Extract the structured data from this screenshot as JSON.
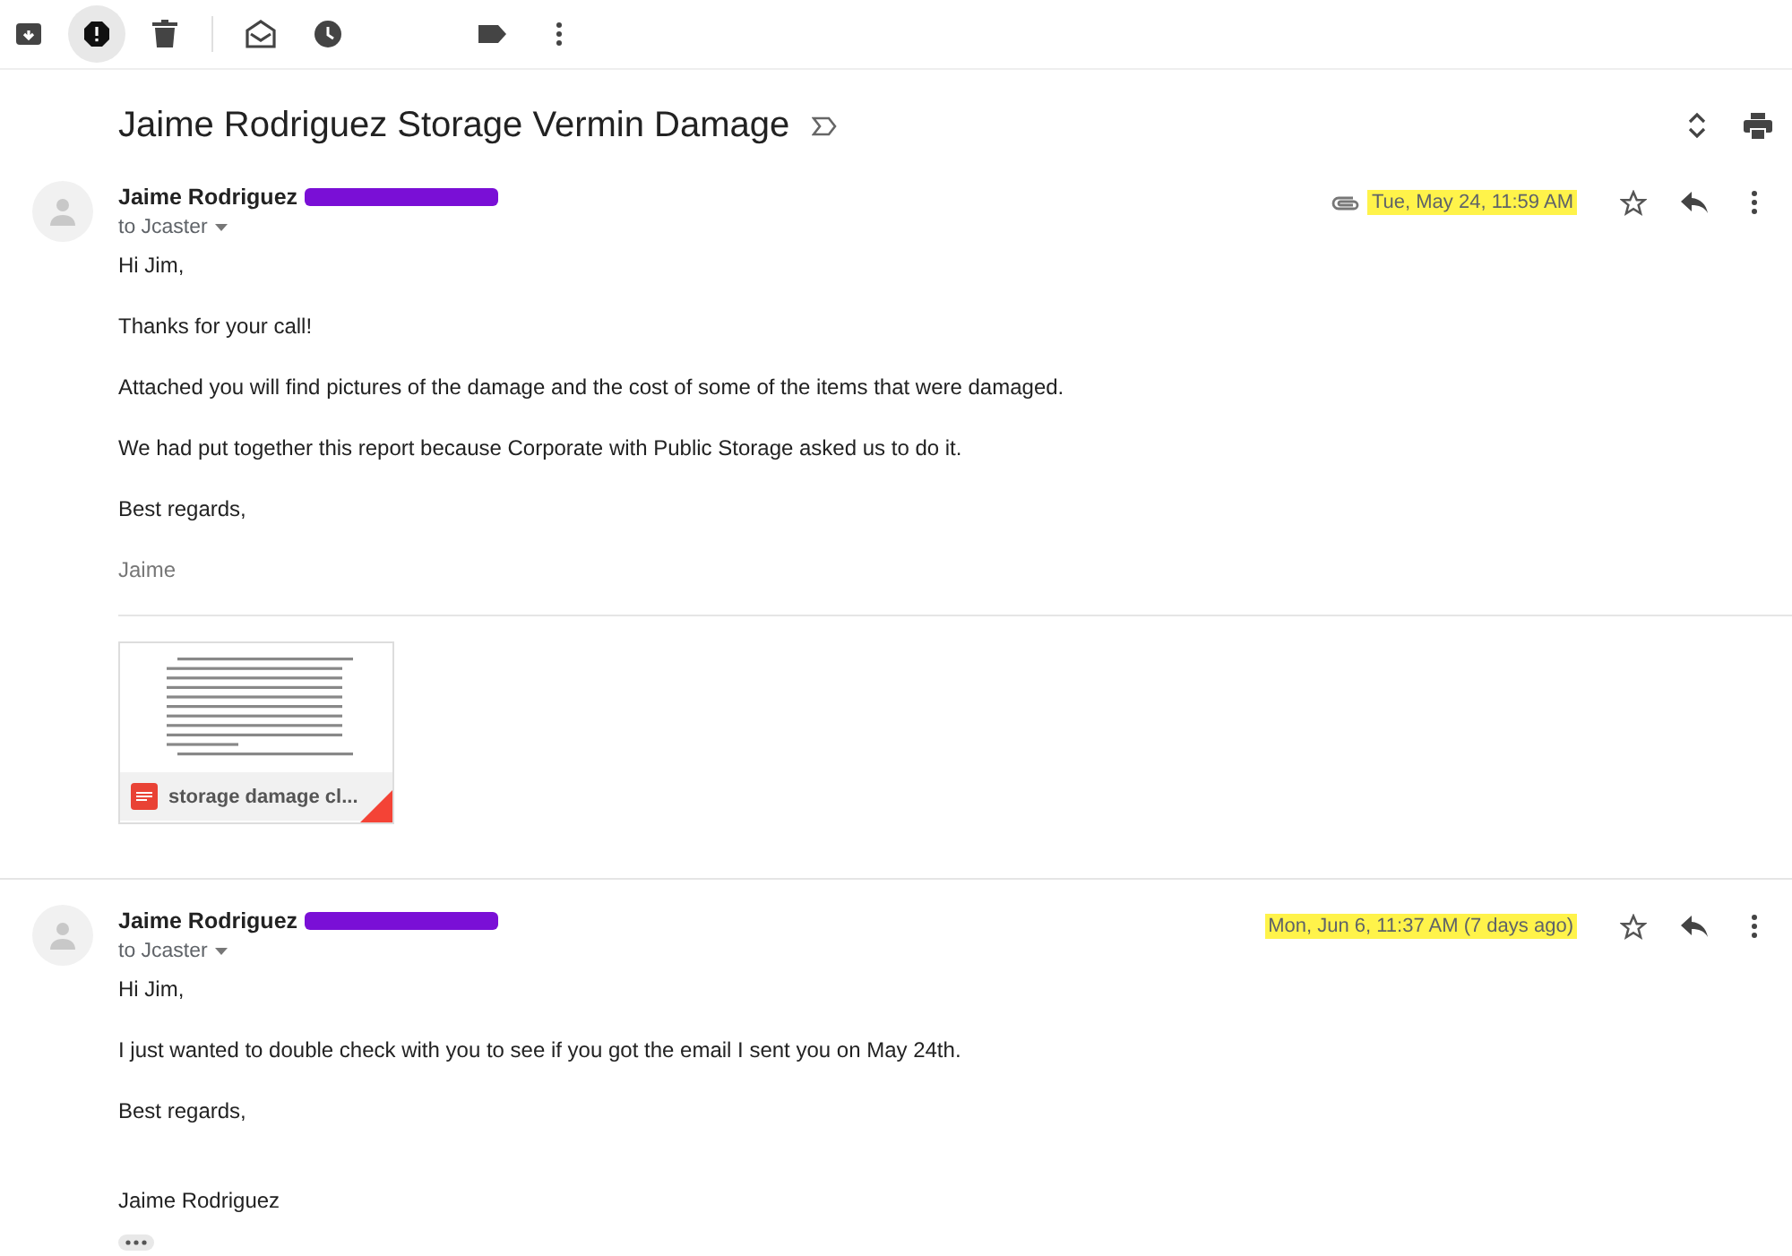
{
  "toolbar_groups": [
    {
      "buttons": [
        {
          "kind": "archive",
          "selected": false
        },
        {
          "kind": "spam",
          "selected": true
        },
        {
          "kind": "delete",
          "selected": false
        }
      ]
    },
    {
      "buttons": [
        {
          "kind": "mark-unread",
          "selected": false
        },
        {
          "kind": "snooze",
          "selected": false
        }
      ]
    },
    {
      "buttons": [
        {
          "kind": "label",
          "selected": false
        },
        {
          "kind": "more",
          "selected": false
        }
      ]
    }
  ],
  "subject": "Jaime Rodriguez Storage Vermin Damage",
  "messages": [
    {
      "sender": "Jaime Rodriguez",
      "address_redacted": true,
      "recipient": "to Jcaster",
      "date": "Tue, May 24, 11:59 AM",
      "starred": false,
      "body": [
        {
          "kind": "text",
          "text": "Hi Jim,"
        },
        {
          "kind": "text",
          "text": "Thanks for your call!"
        },
        {
          "kind": "text",
          "text": "Attached you will find pictures of the damage and the cost of some of the items that were damaged."
        },
        {
          "kind": "text",
          "text": "We had put together this report because Corporate with Public Storage asked us to do it."
        },
        {
          "kind": "text",
          "text": "Best regards,"
        },
        {
          "kind": "signature",
          "text": "Jaime"
        }
      ],
      "attachments": [
        {
          "name": "storage damage cl..."
        }
      ]
    },
    {
      "sender": "Jaime Rodriguez",
      "address_redacted": true,
      "recipient": "to Jcaster",
      "date": "Mon, Jun 6, 11:37 AM (7 days ago)",
      "starred": false,
      "body": [
        {
          "kind": "text",
          "text": "Hi Jim,"
        },
        {
          "kind": "text",
          "text": "I just wanted to double check with you to see if you got the email I sent you on May 24th."
        },
        {
          "kind": "text",
          "text": "Best regards,"
        },
        {
          "kind": "gap",
          "text": "Jaime Rodriguez"
        }
      ],
      "trimmed": true
    }
  ]
}
